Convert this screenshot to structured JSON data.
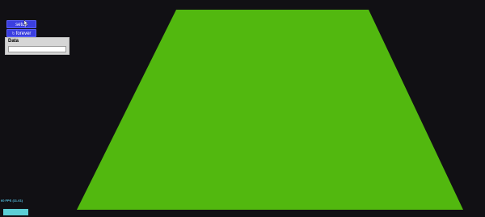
{
  "scene": {
    "background_color": "#111014",
    "plane_color": "#52b80f"
  },
  "controls": {
    "setup_label": "setup",
    "forever_label": "forever",
    "forever_icon": "loop-icon",
    "button_color": "#3b3fe0"
  },
  "data_panel": {
    "label": "Data",
    "input_value": ""
  },
  "stats": {
    "fps_text": "60 FPS (11-61)",
    "bar_color": "#5ccfd6"
  }
}
